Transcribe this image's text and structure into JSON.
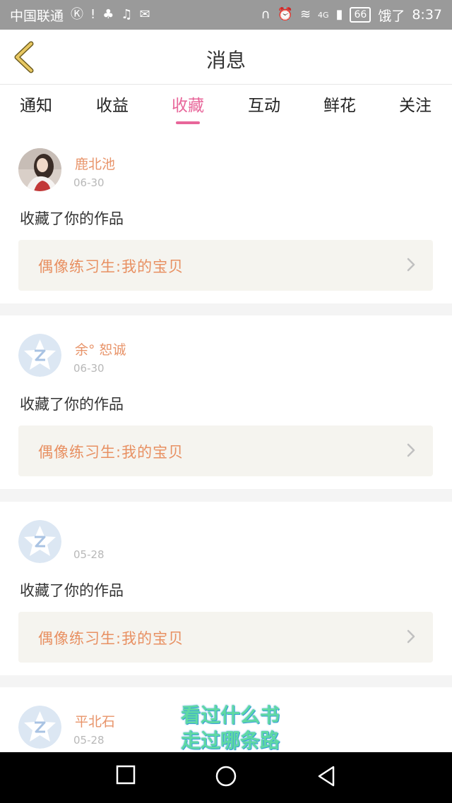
{
  "status_bar": {
    "carrier": "中国联通",
    "battery": "66",
    "right_text": "饿了",
    "time": "8:37",
    "net": "4G"
  },
  "nav": {
    "title": "消息"
  },
  "tabs": [
    {
      "label": "通知"
    },
    {
      "label": "收益"
    },
    {
      "label": "收藏"
    },
    {
      "label": "互动"
    },
    {
      "label": "鲜花"
    },
    {
      "label": "关注"
    }
  ],
  "active_tab": "收藏",
  "colors": {
    "accent": "#e8669a",
    "name": "#e8946a",
    "work": "#e89062",
    "back": "#e0c060"
  },
  "items": [
    {
      "name": "鹿北池",
      "date": "06-30",
      "message": "收藏了你的作品",
      "work": "偶像练习生:我的宝贝",
      "avatar": "photo"
    },
    {
      "name": "余° 恕诚",
      "date": "06-30",
      "message": "收藏了你的作品",
      "work": "偶像练习生:我的宝贝",
      "avatar": "qzone-default"
    },
    {
      "name": "",
      "date": "05-28",
      "message": "收藏了你的作品",
      "work": "偶像练习生:我的宝贝",
      "avatar": "qzone-default"
    },
    {
      "name": "平北石",
      "date": "05-28",
      "message": "",
      "work": "",
      "avatar": "qzone-default"
    }
  ],
  "watermark": {
    "line1": "看过什么书",
    "line2": "走过哪条路"
  }
}
